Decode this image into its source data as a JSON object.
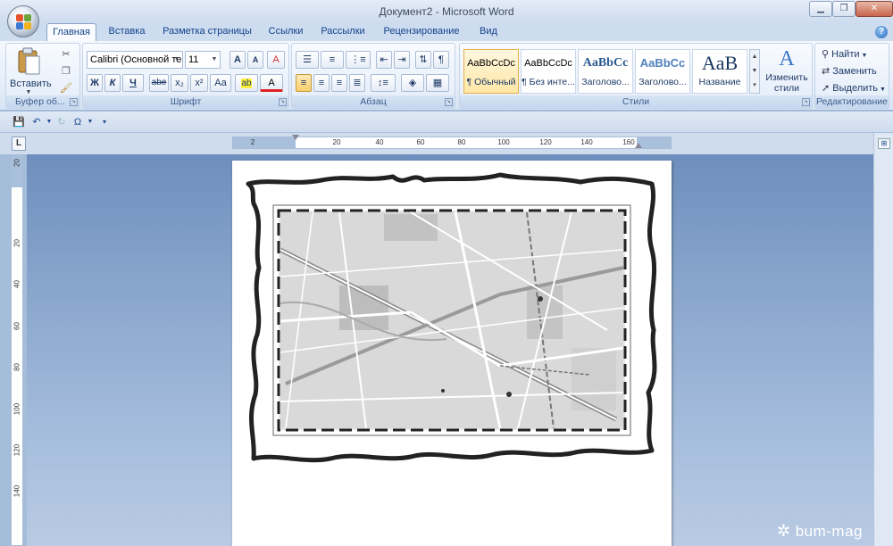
{
  "window": {
    "title": "Документ2 - Microsoft Word",
    "controls": [
      "minimize",
      "maximize",
      "close"
    ]
  },
  "tabs": [
    {
      "label": "Главная",
      "active": true
    },
    {
      "label": "Вставка"
    },
    {
      "label": "Разметка страницы"
    },
    {
      "label": "Ссылки"
    },
    {
      "label": "Рассылки"
    },
    {
      "label": "Рецензирование"
    },
    {
      "label": "Вид"
    }
  ],
  "ribbon": {
    "clipboard": {
      "paste_label": "Вставить",
      "group_label": "Буфер об..."
    },
    "font": {
      "font_name": "Calibri (Основной те",
      "font_size": "11",
      "bold": "Ж",
      "italic": "К",
      "underline": "Ч",
      "strike": "abe",
      "subscript": "x₂",
      "superscript": "x²",
      "change_case": "Aa",
      "highlight": "ab",
      "font_color": "A",
      "grow": "A",
      "shrink": "A",
      "clear": "A",
      "group_label": "Шрифт"
    },
    "paragraph": {
      "group_label": "Абзац",
      "pilcrow": "¶"
    },
    "styles": {
      "group_label": "Стили",
      "items": [
        {
          "sample": "AaBbCcDc",
          "name": "¶ Обычный",
          "selected": true
        },
        {
          "sample": "AaBbCcDc",
          "name": "¶ Без инте..."
        },
        {
          "sample": "AaBbCc",
          "name": "Заголово..."
        },
        {
          "sample": "AaBbCc",
          "name": "Заголово..."
        },
        {
          "sample": "AaB",
          "name": "Название"
        }
      ],
      "change_styles": "Изменить стили"
    },
    "editing": {
      "group_label": "Редактирование",
      "find": "Найти",
      "replace": "Заменить",
      "select": "Выделить"
    }
  },
  "ruler": {
    "h_labels": [
      "2",
      "20",
      "40",
      "60",
      "80",
      "100",
      "120",
      "140",
      "160"
    ],
    "v_labels": [
      "20",
      "20",
      "40",
      "60",
      "80",
      "100",
      "120",
      "140"
    ]
  },
  "watermark": "bum-mag",
  "colors": {
    "ribbon_bg": "#e6eef9",
    "workspace": "#a4bcdc",
    "accent": "#15428b"
  }
}
